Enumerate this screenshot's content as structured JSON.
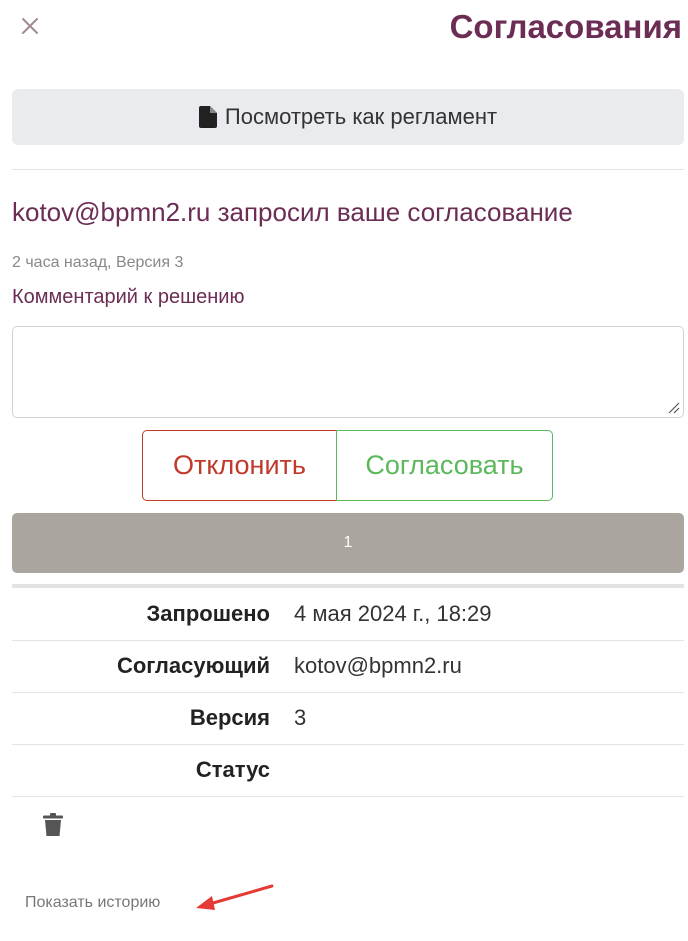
{
  "header": {
    "title": "Согласования",
    "close_icon": "close-icon"
  },
  "actions": {
    "view_as_regulation_label": "Посмотреть как регламент",
    "view_icon": "file-icon"
  },
  "request": {
    "heading": "kotov@bpmn2.ru запросил ваше согласование",
    "meta": "2 часа назад, Версия 3",
    "comment_label": "Комментарий к решению",
    "comment_value": ""
  },
  "decision": {
    "reject_label": "Отклонить",
    "approve_label": "Согласовать"
  },
  "progress": {
    "label": "1"
  },
  "details": {
    "rows": [
      {
        "label": "Запрошено",
        "value": "4 мая 2024 г., 18:29"
      },
      {
        "label": "Согласующий",
        "value": "kotov@bpmn2.ru"
      },
      {
        "label": "Версия",
        "value": "3"
      },
      {
        "label": "Статус",
        "value": ""
      }
    ]
  },
  "footer": {
    "delete_icon": "trash-icon",
    "show_history_label": "Показать историю"
  },
  "colors": {
    "brand": "#6b2d54",
    "reject": "#c0392b",
    "approve": "#5cb85c",
    "progress_bg": "#aaa59f",
    "arrow": "#e53935"
  }
}
